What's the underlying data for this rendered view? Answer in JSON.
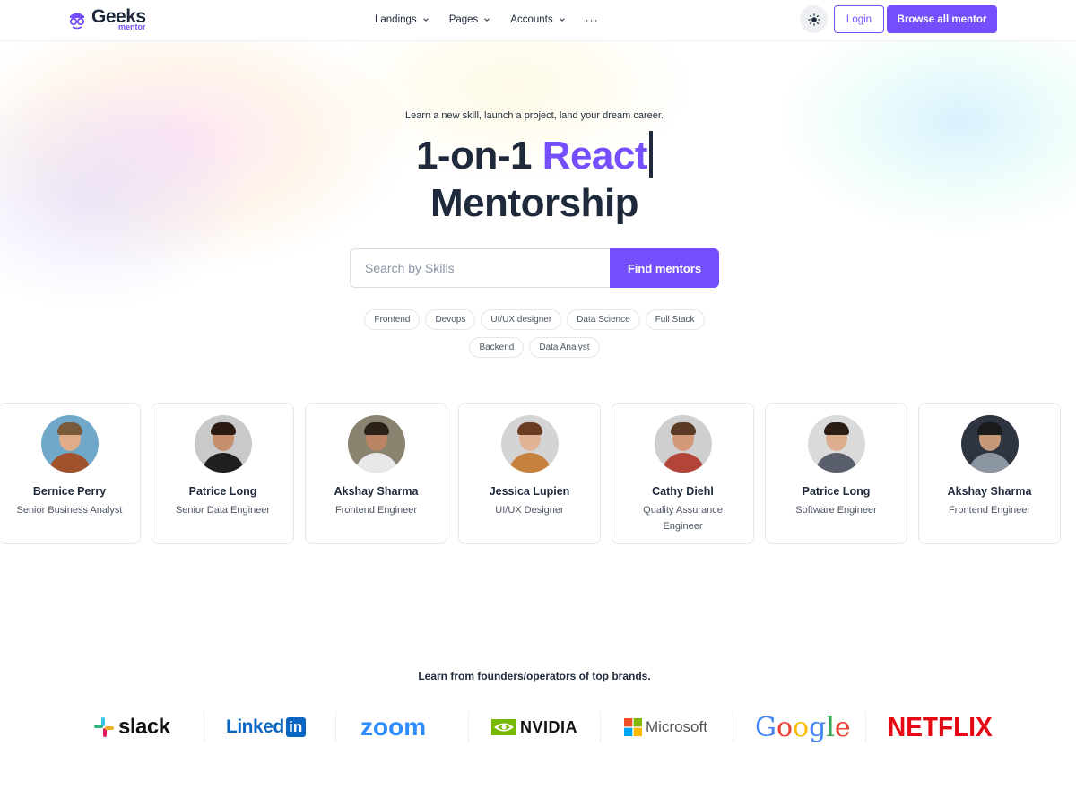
{
  "nav": {
    "logo_main": "Geeks",
    "logo_sub": "mentor",
    "menu": [
      "Landings",
      "Pages",
      "Accounts"
    ],
    "more": "···",
    "login": "Login",
    "browse": "Browse all mentor"
  },
  "hero": {
    "tagline": "Learn a new skill, launch a project, land your dream career.",
    "title_prefix": "1-on-1",
    "title_accent": "React",
    "title_line2": "Mentorship",
    "search_placeholder": "Search by Skills",
    "search_button": "Find mentors",
    "chips": [
      "Frontend",
      "Devops",
      "UI/UX designer",
      "Data Science",
      "Full Stack",
      "Backend",
      "Data Analyst"
    ]
  },
  "mentors": [
    {
      "name": "Bernice Perry",
      "role": "Senior Business Analyst"
    },
    {
      "name": "Patrice Long",
      "role": "Senior Data Engineer"
    },
    {
      "name": "Akshay Sharma",
      "role": "Frontend Engineer"
    },
    {
      "name": "Jessica Lupien",
      "role": "UI/UX Designer"
    },
    {
      "name": "Cathy Diehl",
      "role": "Quality Assurance Engineer"
    },
    {
      "name": "Patrice Long",
      "role": "Software Engineer"
    },
    {
      "name": "Akshay Sharma",
      "role": "Frontend Engineer"
    }
  ],
  "brands": {
    "title": "Learn from founders/operators of top brands.",
    "slack": "slack",
    "linkedin": "Linked",
    "linkedin_in": "in",
    "zoom": "zoom",
    "nvidia": "NVIDIA",
    "microsoft": "Microsoft",
    "google": "Google",
    "netflix": "NETFLIX"
  },
  "colors": {
    "accent": "#754ffe",
    "text": "#1e293b"
  }
}
